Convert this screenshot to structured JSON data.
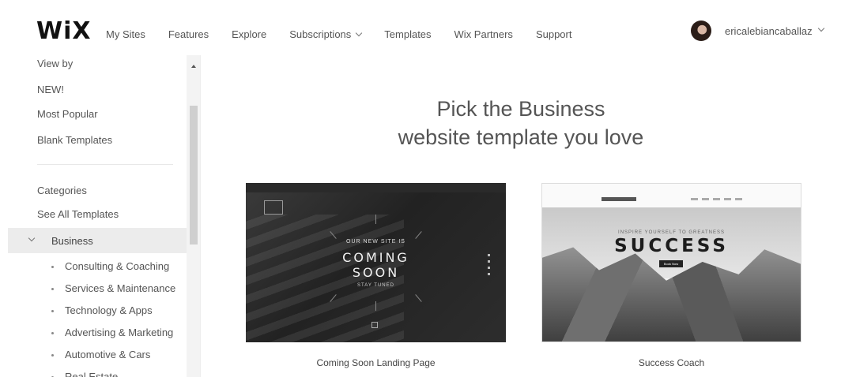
{
  "header": {
    "logo": "WiX",
    "nav": [
      {
        "label": "My Sites"
      },
      {
        "label": "Features"
      },
      {
        "label": "Explore"
      },
      {
        "label": "Subscriptions",
        "has_dropdown": true
      },
      {
        "label": "Templates"
      },
      {
        "label": "Wix Partners"
      },
      {
        "label": "Support"
      }
    ],
    "username": "ericalebiancaballaz"
  },
  "sidebar": {
    "view_by": "View by",
    "new": "NEW!",
    "most_popular": "Most Popular",
    "blank": "Blank Templates",
    "categories": "Categories",
    "see_all": "See All Templates",
    "active_category": "Business",
    "subcategories": [
      "Consulting & Coaching",
      "Services & Maintenance",
      "Technology & Apps",
      "Advertising & Marketing",
      "Automotive & Cars",
      "Real Estate"
    ]
  },
  "main": {
    "heading_line1": "Pick the Business",
    "heading_line2": "website template you love",
    "templates": [
      {
        "caption": "Coming Soon Landing Page",
        "preview_small": "OUR NEW SITE IS",
        "preview_title_1": "COMING",
        "preview_title_2": "SOON",
        "preview_sub": "STAY TUNED"
      },
      {
        "caption": "Success Coach",
        "preview_small": "INSPIRE YOURSELF TO GREATNESS",
        "preview_title": "SUCCESS",
        "preview_button": "Book Now"
      }
    ]
  },
  "colors": {
    "sidebar_active_bg": "#ececec",
    "text": "#555555",
    "logo": "#111111"
  }
}
